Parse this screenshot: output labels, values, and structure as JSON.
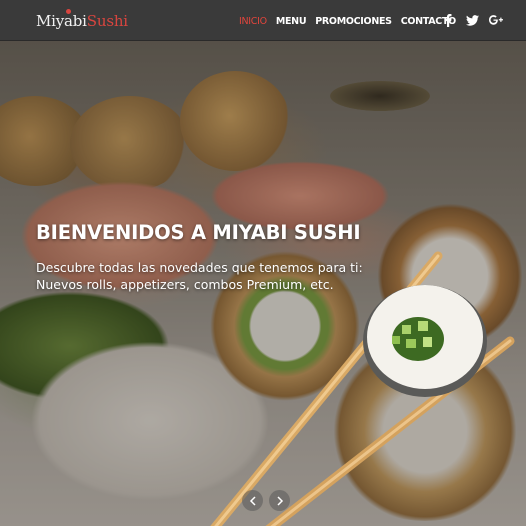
{
  "brand": {
    "name_part1": "Miyabi",
    "name_part2": "Sushi",
    "accent_color": "#e0453c"
  },
  "nav": {
    "items": [
      {
        "label": "INICIO",
        "active": true
      },
      {
        "label": "MENU",
        "active": false
      },
      {
        "label": "PROMOCIONES",
        "active": false
      },
      {
        "label": "CONTACTO",
        "active": false
      }
    ],
    "social_icons": [
      "facebook-icon",
      "twitter-icon",
      "google-plus-icon"
    ]
  },
  "hero": {
    "title": "BIENVENIDOS A MIYABI SUSHI",
    "text": "Descubre todas las novedades que tenemos para ti: Nuevos rolls, appetizers, combos Premium, etc.",
    "controls": [
      "previous-arrow-icon",
      "next-arrow-icon"
    ]
  }
}
